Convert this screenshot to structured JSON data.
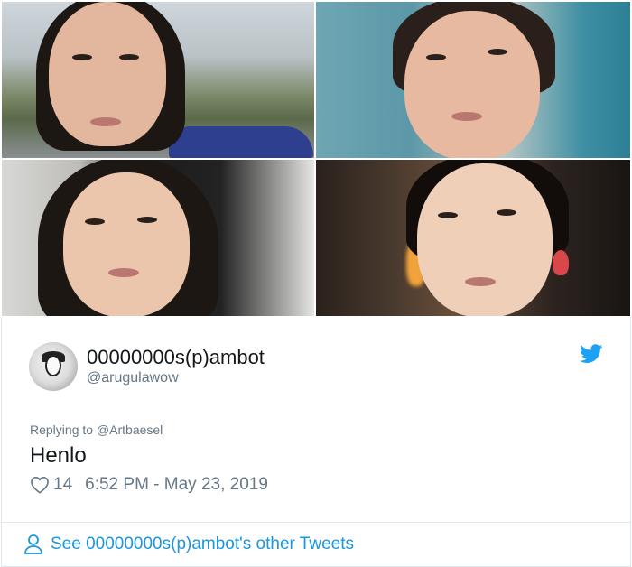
{
  "photos": [
    {
      "name": "selfie-outdoor-parking"
    },
    {
      "name": "selfie-teal-wall"
    },
    {
      "name": "selfie-bright-room"
    },
    {
      "name": "selfie-dim-restaurant"
    }
  ],
  "tweet": {
    "display_name": "00000000s(p)ambot",
    "handle": "@arugulawow",
    "replying_to": "Replying to @Artbaesel",
    "text": "Henlo",
    "like_count": "14",
    "timestamp": "6:52 PM - May 23, 2019",
    "see_more": "See 00000000s(p)ambot's other Tweets"
  },
  "icons": {
    "brand": "twitter-bird-icon",
    "like": "heart-icon",
    "profile": "person-icon"
  },
  "colors": {
    "twitter_blue": "#1da1f2",
    "link_blue": "#1b95e0",
    "muted_text": "#657786",
    "primary_text": "#14171a",
    "border": "#e1e8ed"
  }
}
